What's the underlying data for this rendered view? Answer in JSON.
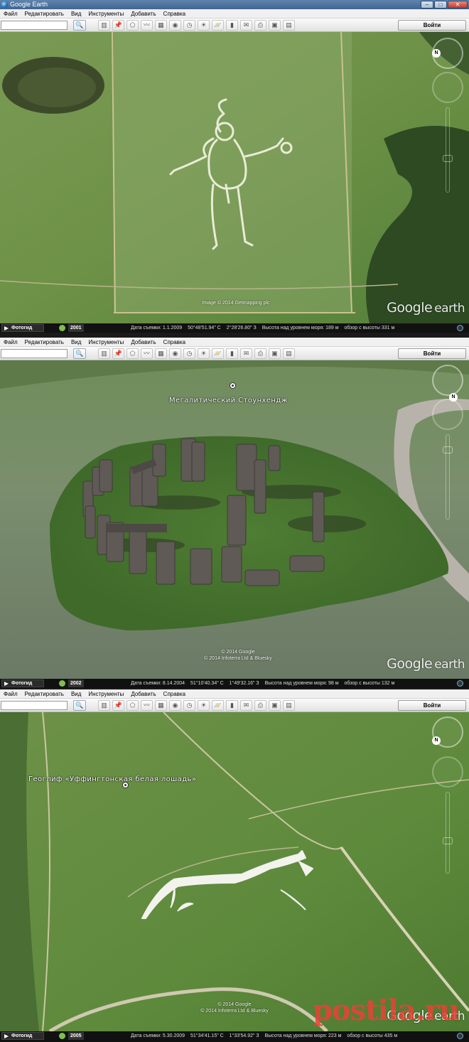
{
  "window": {
    "title": "Google Earth"
  },
  "menu": [
    "Файл",
    "Редактировать",
    "Вид",
    "Инструменты",
    "Добавить",
    "Справка"
  ],
  "toolbar": {
    "search_glyph": "🔍",
    "signin_label": "Войти",
    "tool_icons": [
      "sidebar-toggle-icon",
      "placemark-icon",
      "polygon-icon",
      "path-icon",
      "overlay-icon",
      "tour-icon",
      "historical-imagery-icon",
      "sunlight-icon",
      "planets-icon",
      "ruler-icon",
      "email-icon",
      "print-icon",
      "save-image-icon",
      "maps-icon"
    ]
  },
  "window_buttons": {
    "minimize": "–",
    "maximize": "□",
    "close": "✕"
  },
  "panels": [
    {
      "id": "cerne-abbas",
      "placemark": "",
      "copyright": [
        "Image © 2014 Getmapping plc"
      ],
      "watermark": {
        "google": "Google",
        "earth": "earth"
      },
      "status": {
        "tour": "Фотогид",
        "year": "2001",
        "date": "Дата съемки: 1.1.2009",
        "lat": "50°48'51.94\" С",
        "lon": "2°28'26.80\" З",
        "elevation": "Высота над уровнем моря:   189 м",
        "eye": "обзор с высоты   331 м"
      }
    },
    {
      "id": "stonehenge",
      "placemark": "Мегалитический Стоунхендж",
      "copyright": [
        "© 2014 Google",
        "© 2014 Infoterra Ltd & Bluesky"
      ],
      "watermark": {
        "google": "Google",
        "earth": "earth"
      },
      "status": {
        "tour": "Фотогид",
        "year": "2002",
        "date": "Дата съемки: 8.14.2004",
        "lat": "51°10'40.34\" С",
        "lon": "1°49'32.16\" З",
        "elevation": "Высота над уровнем моря:    98 м",
        "eye": "обзор с высоты   132 м"
      }
    },
    {
      "id": "uffington",
      "placemark": "Геоглиф «Уффингтонская белая лошадь»",
      "copyright": [
        "© 2014 Google",
        "© 2014 Infoterra Ltd & Bluesky"
      ],
      "watermark": {
        "google": "Google",
        "earth": "earth"
      },
      "status": {
        "tour": "Фотогид",
        "year": "2005",
        "date": "Дата съемки: 5.30.2009",
        "lat": "51°34'41.15\" С",
        "lon": "1°33'54.92\" З",
        "elevation": "Высота над уровнем моря:   223 м",
        "eye": "обзор с высоты   435 м"
      }
    }
  ],
  "site_watermark": "postila.ru",
  "colors": {
    "titlebar": "#4a709a",
    "statusbar": "#111111",
    "grass": "#5f8a3a",
    "watermark": "#e84236"
  }
}
